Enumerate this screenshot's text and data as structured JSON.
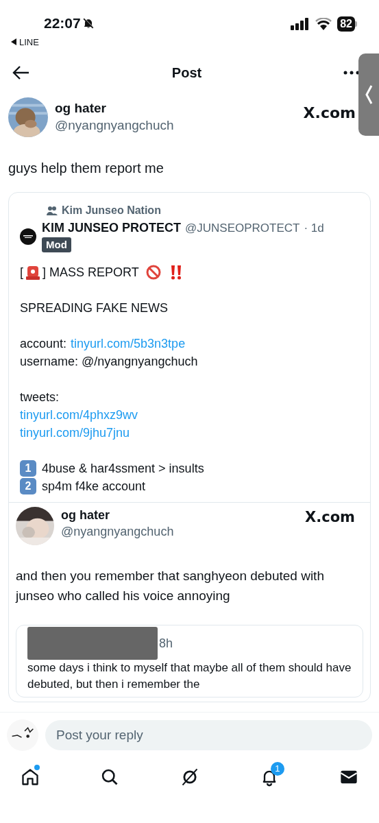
{
  "status_bar": {
    "time": "22:07",
    "muted": true,
    "back_app": "LINE",
    "battery": "82"
  },
  "header": {
    "title": "Post"
  },
  "author": {
    "name": "og hater",
    "handle": "@nyangnyangchuch",
    "source": "X.com"
  },
  "post_text": "guys help them report me",
  "quote": {
    "community": "Kim Junseo Nation",
    "name": "KIM JUNSEO PROTECT",
    "handle": "@JUNSEOPROTECT",
    "time": "· 1d",
    "badge": "Mod",
    "headline": {
      "open": "[",
      "close": "] MASS REPORT"
    },
    "paragraphs": [
      [
        {
          "kind": "text",
          "text": "SPREADING FAKE NEWS"
        }
      ],
      [
        {
          "kind": "labeled_link",
          "label": "account:",
          "link": "tinyurl.com/5b3n3tpe"
        },
        {
          "kind": "text",
          "text": "username: @/nyangnyangchuch"
        }
      ],
      [
        {
          "kind": "text",
          "text": "tweets:"
        },
        {
          "kind": "link",
          "link": "tinyurl.com/4phxz9wv"
        },
        {
          "kind": "link",
          "link": "tinyurl.com/9jhu7jnu"
        }
      ],
      [
        {
          "kind": "numbered",
          "number": "1",
          "text": "4buse & har4ssment > insults"
        },
        {
          "kind": "numbered",
          "number": "2",
          "text": "sp4m f4ke account"
        }
      ]
    ],
    "embedded": {
      "name": "og hater",
      "handle": "@nyangnyangchuch",
      "source": "X.com",
      "text": "and then you remember that sanghyeon debuted with junseo who called his voice annoying",
      "quoted": {
        "time": "8h",
        "text": "some days i think to myself that maybe all of them should have debuted, but then i remember the"
      }
    }
  },
  "reply": {
    "placeholder": "Post your reply"
  },
  "nav": [
    {
      "kind": "home",
      "dot": true
    },
    {
      "kind": "search"
    },
    {
      "kind": "grok"
    },
    {
      "kind": "notifications",
      "badge": "1"
    },
    {
      "kind": "messages"
    }
  ]
}
